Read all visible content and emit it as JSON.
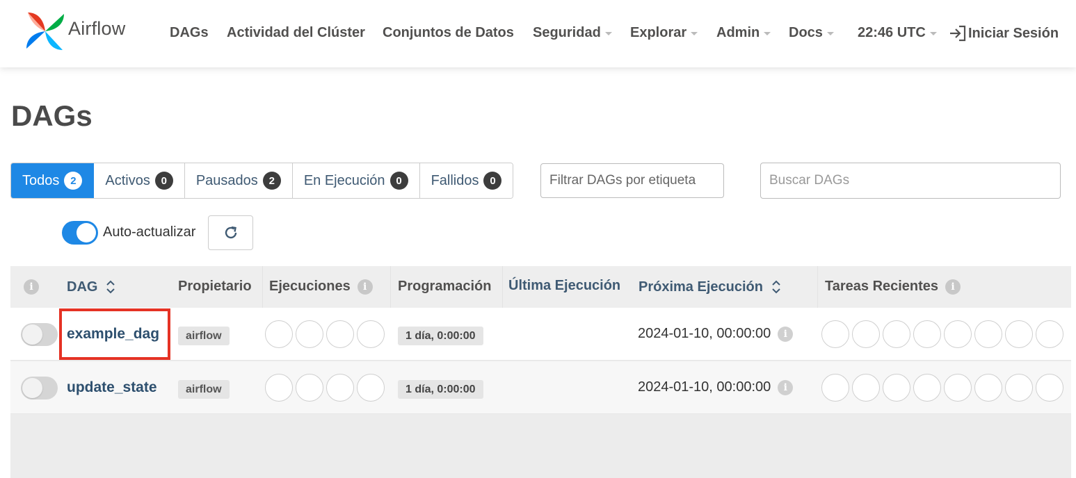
{
  "brand": {
    "name": "Airflow"
  },
  "nav": {
    "dags": "DAGs",
    "cluster_activity": "Actividad del Clúster",
    "datasets": "Conjuntos de Datos",
    "security": "Seguridad",
    "browse": "Explorar",
    "admin": "Admin",
    "docs": "Docs",
    "time": "22:46 UTC",
    "login": "Iniciar Sesión"
  },
  "page": {
    "title": "DAGs"
  },
  "filters": {
    "tabs": [
      {
        "label": "Todos",
        "count": "2",
        "active": true
      },
      {
        "label": "Activos",
        "count": "0",
        "active": false
      },
      {
        "label": "Pausados",
        "count": "2",
        "active": false
      },
      {
        "label": "En Ejecución",
        "count": "0",
        "active": false
      },
      {
        "label": "Fallidos",
        "count": "0",
        "active": false
      }
    ],
    "tag_placeholder": "Filtrar DAGs por etiqueta",
    "search_placeholder": "Buscar DAGs"
  },
  "auto_refresh": {
    "label": "Auto-actualizar",
    "enabled": true
  },
  "table": {
    "headers": {
      "info": "i",
      "dag": "DAG",
      "owner": "Propietario",
      "runs": "Ejecuciones",
      "schedule": "Programación",
      "last_run": "Última Ejecución",
      "next_run": "Próxima Ejecución",
      "recent_tasks": "Tareas Recientes"
    },
    "rows": [
      {
        "dag_id": "example_dag",
        "owner": "airflow",
        "schedule": "1 día, 0:00:00",
        "last_run": "",
        "next_run": "2024-01-10, 00:00:00",
        "paused": true,
        "highlighted": true
      },
      {
        "dag_id": "update_state",
        "owner": "airflow",
        "schedule": "1 día, 0:00:00",
        "last_run": "",
        "next_run": "2024-01-10, 00:00:00",
        "paused": true,
        "highlighted": false
      }
    ]
  },
  "colors": {
    "accent": "#1e88e5",
    "highlight": "#e53224",
    "link": "#2d4f6e"
  }
}
